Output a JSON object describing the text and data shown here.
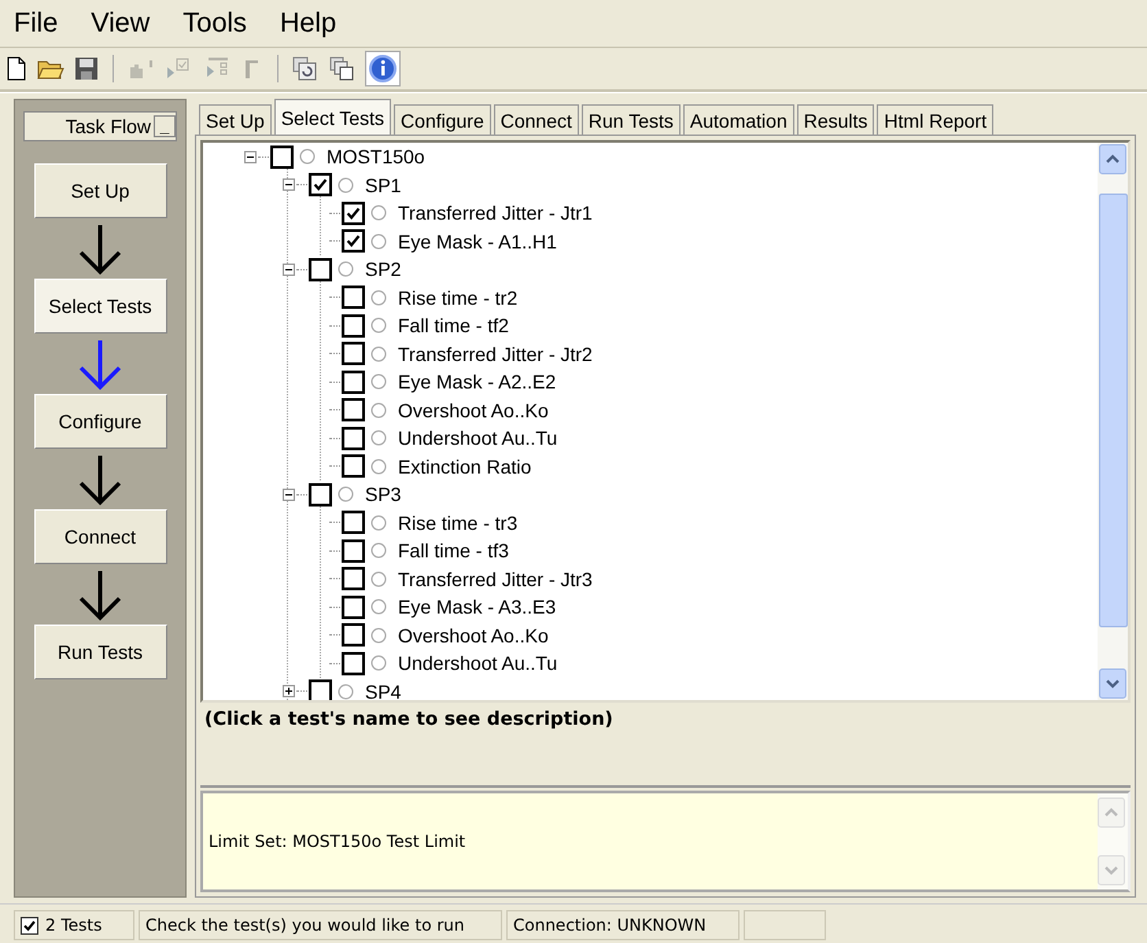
{
  "menu": [
    "File",
    "View",
    "Tools",
    "Help"
  ],
  "toolbar": [
    {
      "kind": "new",
      "disabled": false,
      "pressed": false
    },
    {
      "kind": "open",
      "disabled": false,
      "pressed": false
    },
    {
      "kind": "save",
      "disabled": false,
      "pressed": false
    },
    {
      "kind": "sep"
    },
    {
      "kind": "chart",
      "disabled": true,
      "pressed": false
    },
    {
      "kind": "run-check",
      "disabled": true,
      "pressed": false
    },
    {
      "kind": "run-list",
      "disabled": true,
      "pressed": false
    },
    {
      "kind": "bracket",
      "disabled": true,
      "pressed": false
    },
    {
      "kind": "sep"
    },
    {
      "kind": "refresh",
      "disabled": false,
      "pressed": false
    },
    {
      "kind": "copy",
      "disabled": false,
      "pressed": false
    },
    {
      "kind": "info",
      "disabled": false,
      "pressed": true
    }
  ],
  "task_flow": {
    "title": "Task Flow",
    "minimize": "_",
    "steps": [
      {
        "label": "Set Up",
        "selected": false
      },
      {
        "label": "Select Tests",
        "selected": true
      },
      {
        "label": "Configure",
        "selected": false
      },
      {
        "label": "Connect",
        "selected": false
      },
      {
        "label": "Run Tests",
        "selected": false
      }
    ]
  },
  "tabs": [
    {
      "label": "Set Up",
      "selected": false
    },
    {
      "label": "Select Tests",
      "selected": true
    },
    {
      "label": "Configure",
      "selected": false
    },
    {
      "label": "Connect",
      "selected": false
    },
    {
      "label": "Run Tests",
      "selected": false
    },
    {
      "label": "Automation",
      "selected": false
    },
    {
      "label": "Results",
      "selected": false
    },
    {
      "label": "Html Report",
      "selected": false
    }
  ],
  "tree": [
    {
      "label": "MOST150o",
      "checked": false,
      "expanded": true,
      "children": [
        {
          "label": "SP1",
          "checked": true,
          "expanded": true,
          "children": [
            {
              "label": "Transferred Jitter - Jtr1",
              "checked": true
            },
            {
              "label": "Eye Mask - A1..H1",
              "checked": true
            }
          ]
        },
        {
          "label": "SP2",
          "checked": false,
          "expanded": true,
          "children": [
            {
              "label": "Rise time - tr2",
              "checked": false
            },
            {
              "label": "Fall time - tf2",
              "checked": false
            },
            {
              "label": "Transferred Jitter - Jtr2",
              "checked": false
            },
            {
              "label": "Eye Mask - A2..E2",
              "checked": false
            },
            {
              "label": "Overshoot Ao..Ko",
              "checked": false
            },
            {
              "label": "Undershoot Au..Tu",
              "checked": false
            },
            {
              "label": "Extinction Ratio",
              "checked": false
            }
          ]
        },
        {
          "label": "SP3",
          "checked": false,
          "expanded": true,
          "children": [
            {
              "label": "Rise time - tr3",
              "checked": false
            },
            {
              "label": "Fall time - tf3",
              "checked": false
            },
            {
              "label": "Transferred Jitter - Jtr3",
              "checked": false
            },
            {
              "label": "Eye Mask - A3..E3",
              "checked": false
            },
            {
              "label": "Overshoot Ao..Ko",
              "checked": false
            },
            {
              "label": "Undershoot Au..Tu",
              "checked": false
            }
          ]
        },
        {
          "label": "SP4",
          "checked": false,
          "expanded": false
        }
      ]
    }
  ],
  "description": "(Click a test's name to see description)",
  "limit_set": "Limit Set: MOST150o Test Limit",
  "status_bar": {
    "tests_checked": true,
    "tests": "2 Tests",
    "message": "Check the test(s) you would like to run",
    "connection": "Connection: UNKNOWN"
  }
}
